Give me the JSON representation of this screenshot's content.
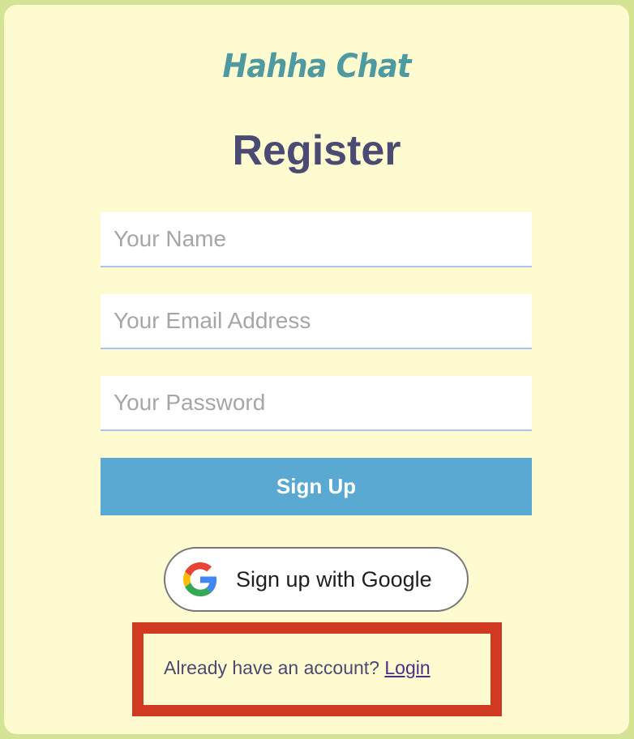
{
  "brand": {
    "name": "Hahha Chat"
  },
  "page": {
    "title": "Register"
  },
  "form": {
    "name_placeholder": "Your Name",
    "email_placeholder": "Your Email Address",
    "password_placeholder": "Your Password",
    "submit_label": "Sign Up"
  },
  "google": {
    "label": "Sign up with Google",
    "icon": "google-g-icon"
  },
  "footer": {
    "prompt": "Already have an account?",
    "login_label": "Login"
  },
  "colors": {
    "background": "#d4e394",
    "card": "#fffbd1",
    "brand": "#4e9aa0",
    "title": "#4a4a72",
    "button": "#59a9d3",
    "highlight": "#d13a22"
  }
}
